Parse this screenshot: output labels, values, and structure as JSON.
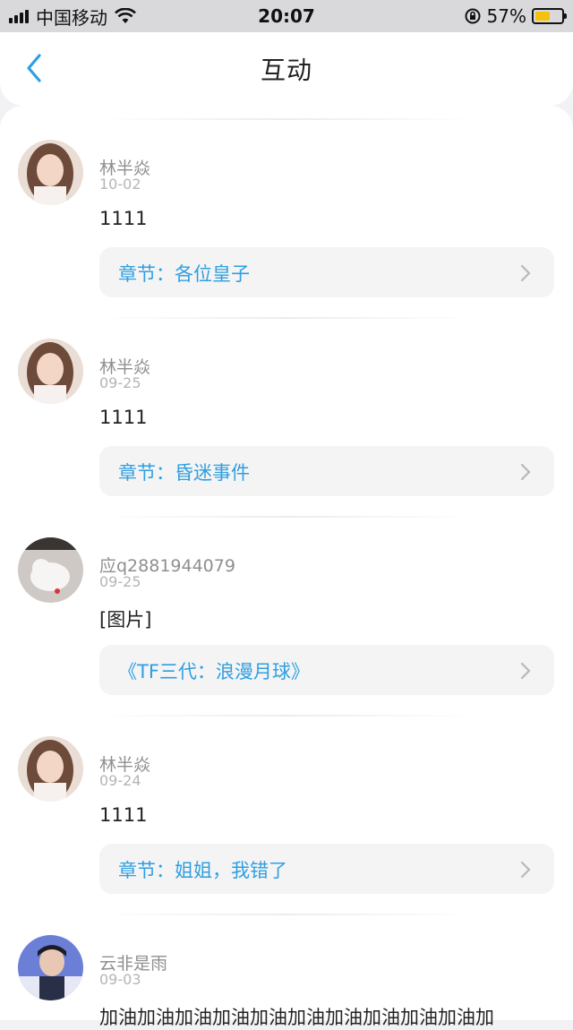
{
  "status_bar": {
    "carrier": "中国移动",
    "time": "20:07",
    "battery": "57%",
    "battery_level": 0.57,
    "icons": [
      "signal-icon",
      "wifi-icon",
      "orientation-lock-icon",
      "battery-icon"
    ]
  },
  "nav": {
    "title": "互动",
    "back_icon": "chevron-left-icon"
  },
  "colors": {
    "accent": "#2f9fe0",
    "battery": "#f4c20d"
  },
  "comments": [
    {
      "user": "林半焱",
      "date": "10-02",
      "text": "1111",
      "link": "章节：各位皇子",
      "avatar": "avatar-girl"
    },
    {
      "user": "林半焱",
      "date": "09-25",
      "text": "1111",
      "link": "章节：昏迷事件",
      "avatar": "avatar-girl"
    },
    {
      "user": "应q2881944079",
      "date": "09-25",
      "text": "[图片]",
      "link": "《TF三代：浪漫月球》",
      "avatar": "avatar-cat"
    },
    {
      "user": "林半焱",
      "date": "09-24",
      "text": "1111",
      "link": "章节：姐姐，我错了",
      "avatar": "avatar-girl"
    },
    {
      "user": "云非是雨",
      "date": "09-03",
      "text": "加油加油加油加油加油加油加油加油加油加油加",
      "link": "",
      "avatar": "avatar-boy"
    }
  ]
}
